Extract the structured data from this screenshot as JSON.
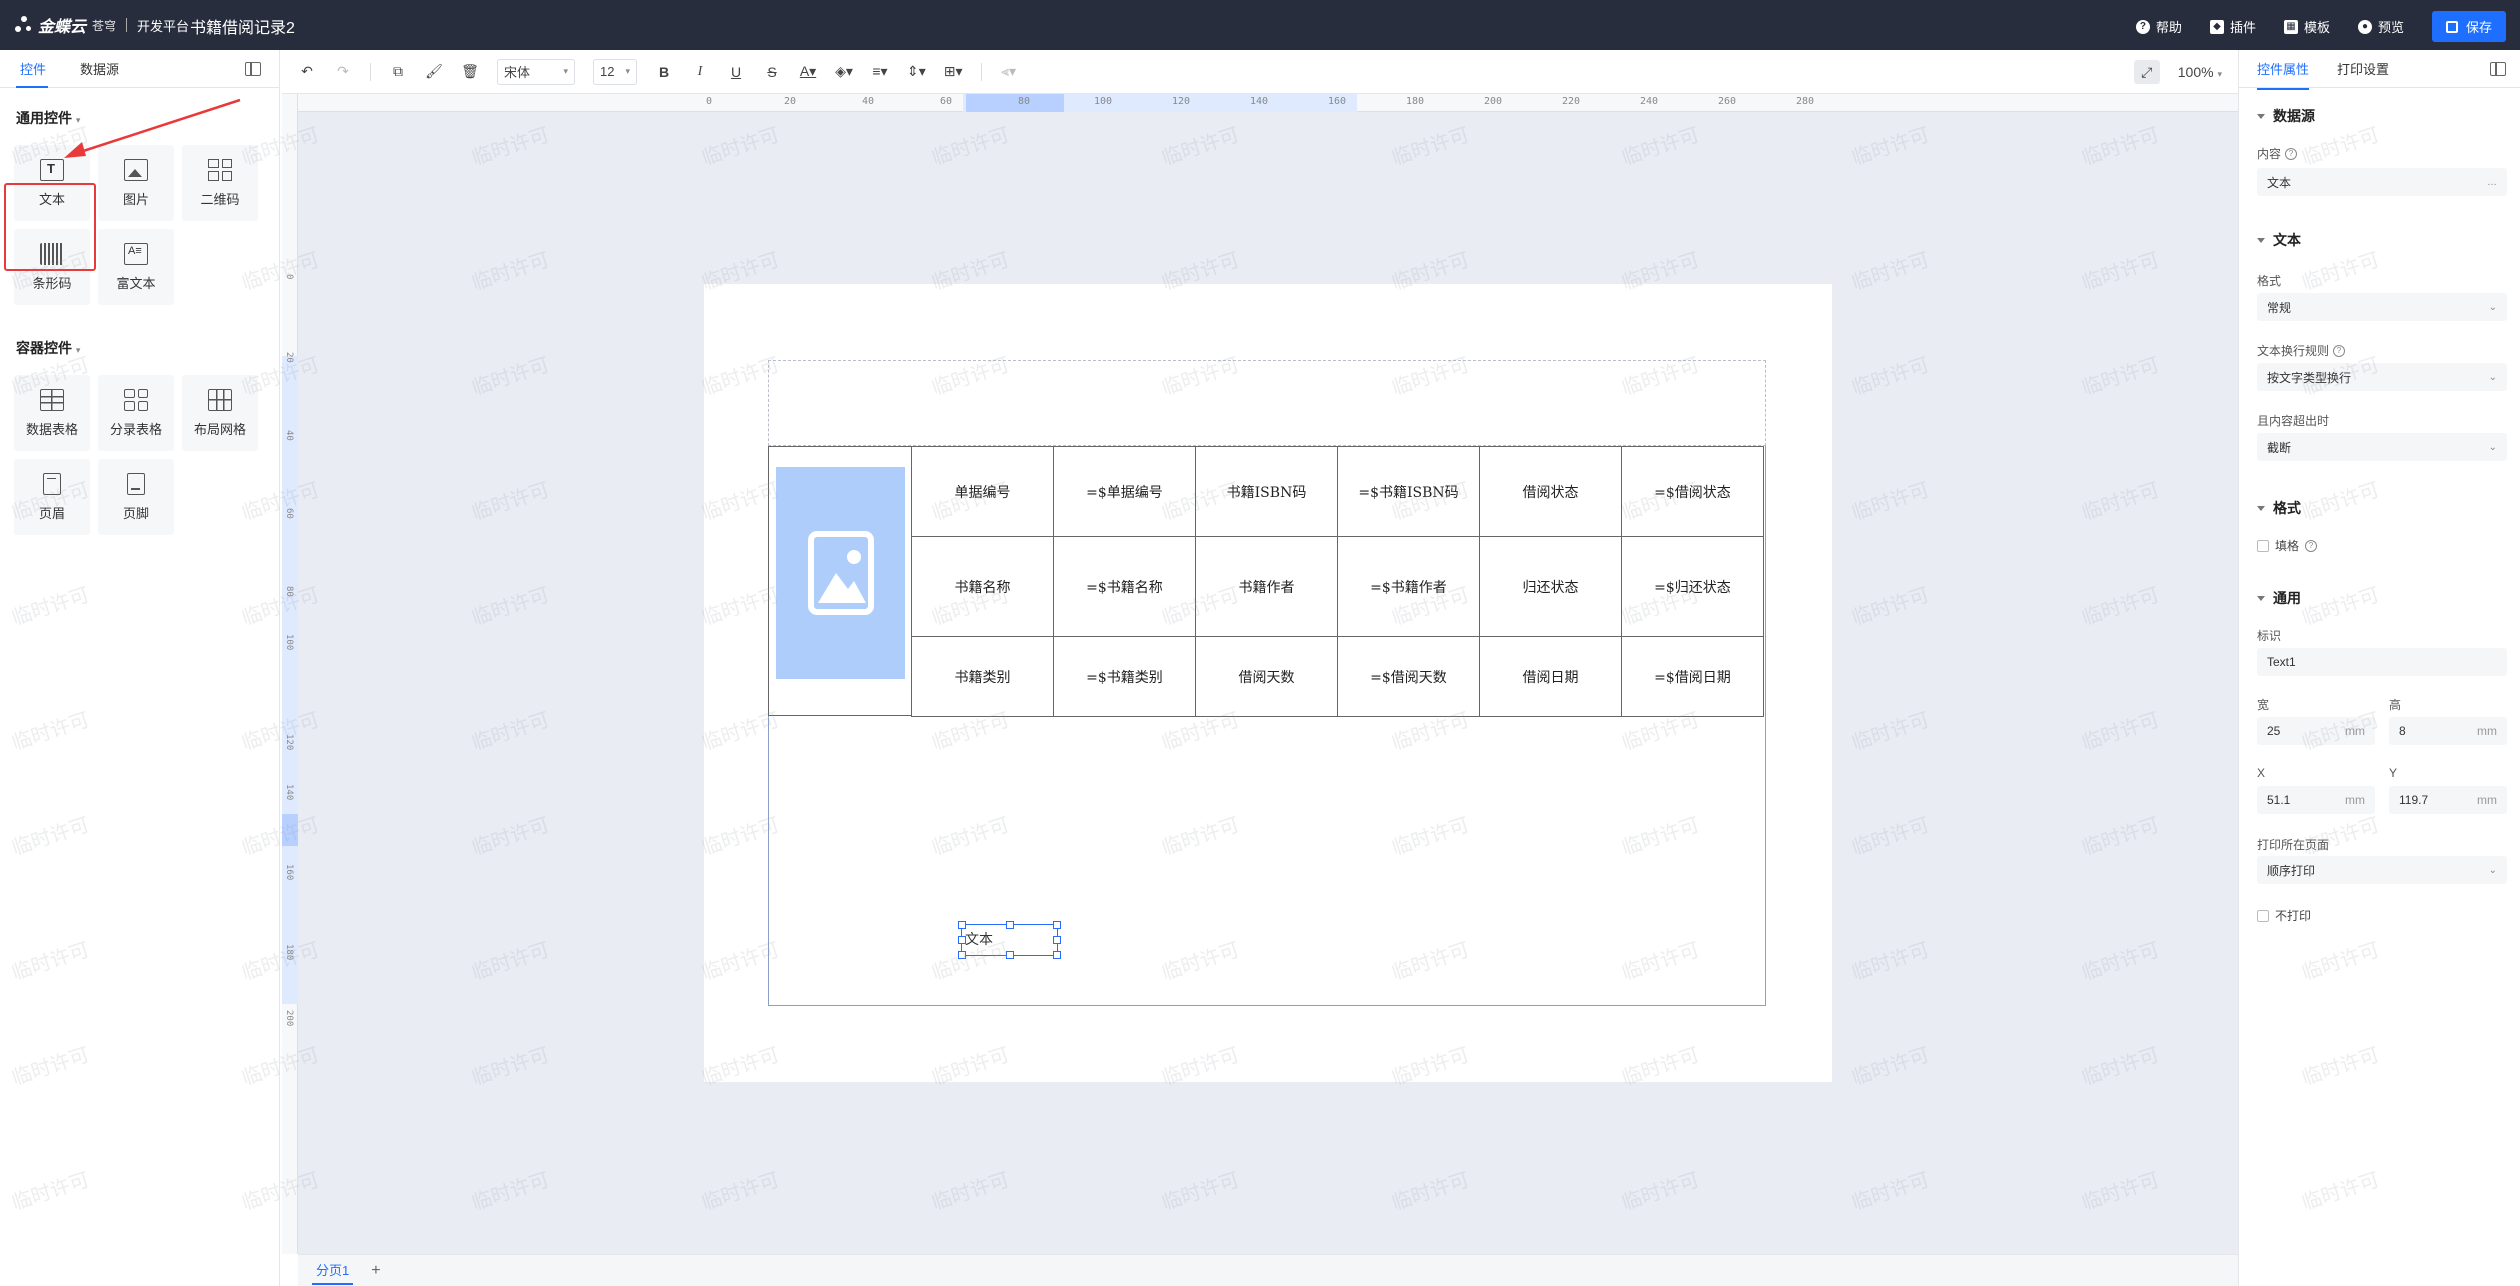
{
  "topbar": {
    "brand_name": "金蝶云",
    "brand_sub": "苍穹",
    "platform": "开发平台",
    "doc_title": "书籍借阅记录2",
    "actions": [
      "帮助",
      "插件",
      "模板",
      "预览"
    ],
    "save_label": "保存"
  },
  "left": {
    "tabs": [
      "控件",
      "数据源"
    ],
    "general_title": "通用控件",
    "general_widgets": [
      "文本",
      "图片",
      "二维码",
      "条形码",
      "富文本"
    ],
    "container_title": "容器控件",
    "container_widgets": [
      "数据表格",
      "分录表格",
      "布局网格",
      "页眉",
      "页脚"
    ]
  },
  "toolbar": {
    "font_family": "宋体",
    "font_size": "12",
    "bold": "B",
    "italic": "I",
    "underline": "U",
    "strike": "S",
    "zoom": "100%"
  },
  "ruler": {
    "h_ticks": [
      "0",
      "20",
      "40",
      "60",
      "80",
      "100",
      "120",
      "140",
      "160",
      "180",
      "200",
      "220",
      "240",
      "260",
      "280"
    ],
    "v_ticks": [
      "0",
      "20",
      "40",
      "60",
      "80",
      "100",
      "120",
      "140",
      "160",
      "180",
      "200"
    ]
  },
  "table": {
    "rows": [
      [
        "单据编号",
        "=$单据编号",
        "书籍ISBN码",
        "=$书籍ISBN码",
        "借阅状态",
        "=$借阅状态"
      ],
      [
        "书籍名称",
        "=$书籍名称",
        "书籍作者",
        "=$书籍作者",
        "归还状态",
        "=$归还状态"
      ],
      [
        "书籍类别",
        "=$书籍类别",
        "借阅天数",
        "=$借阅天数",
        "借阅日期",
        "=$借阅日期"
      ]
    ]
  },
  "text_widget_label": "文本",
  "pagebar": {
    "page": "分页1",
    "add": "+"
  },
  "right": {
    "tabs": [
      "控件属性",
      "打印设置"
    ],
    "datasource_title": "数据源",
    "content_label": "内容",
    "content_value": "文本",
    "text_title": "文本",
    "format_label": "格式",
    "format_value": "常规",
    "wrap_label": "文本换行规则",
    "wrap_value": "按文字类型换行",
    "overflow_label": "且内容超出时",
    "overflow_value": "截断",
    "style_title": "格式",
    "fill_label": "填格",
    "general_title": "通用",
    "id_label": "标识",
    "id_value": "Text1",
    "width_label": "宽",
    "width_value": "25",
    "height_label": "高",
    "height_value": "8",
    "x_label": "X",
    "x_value": "51.1",
    "y_label": "Y",
    "y_value": "119.7",
    "unit": "mm",
    "print_page_label": "打印所在页面",
    "print_page_value": "顺序打印",
    "no_print_label": "不打印"
  },
  "watermark": "临时许可"
}
